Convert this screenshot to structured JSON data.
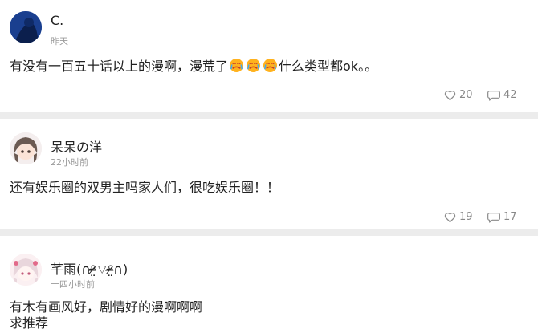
{
  "posts": [
    {
      "username": "C.",
      "time": "昨天",
      "content_before": "有没有一百五十话以上的漫啊，漫荒了",
      "emoji_name": "crying-face-emoji",
      "emoji_count": 3,
      "content_after": "什么类型都ok。。",
      "likes": "20",
      "comments": "42"
    },
    {
      "username": "呆呆の洋",
      "time": "22小时前",
      "content": "还有娱乐圈的双男主吗家人们，很吃娱乐圈！！",
      "likes": "19",
      "comments": "17"
    },
    {
      "username": "芊雨(∩ᵒ̴̶̷̤⌔ᵒ̴̶̷̤∩)",
      "time": "十四小时前",
      "content_line1": "有木有画风好，剧情好的漫啊啊啊",
      "content_line2": "求推荐"
    }
  ],
  "colors": {
    "separator": "#ececec",
    "meta_text": "#9a9a9a",
    "stat_text": "#888888",
    "avatar_1_bg": "#1f4fa8"
  },
  "icons": {
    "like": "heart-outline-icon",
    "comment": "speech-bubble-icon"
  }
}
